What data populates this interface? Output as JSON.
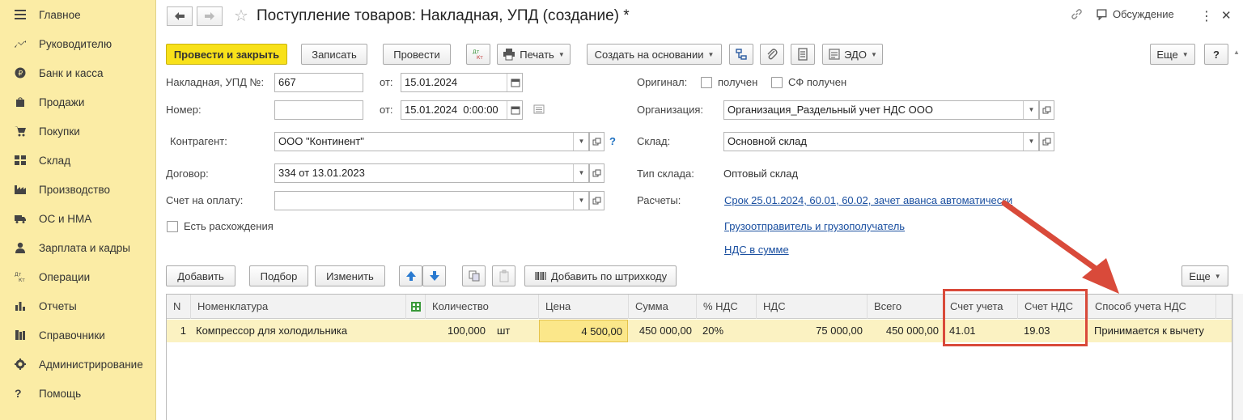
{
  "sidebar": {
    "items": [
      {
        "label": "Главное"
      },
      {
        "label": "Руководителю"
      },
      {
        "label": "Банк и касса"
      },
      {
        "label": "Продажи"
      },
      {
        "label": "Покупки"
      },
      {
        "label": "Склад"
      },
      {
        "label": "Производство"
      },
      {
        "label": "ОС и НМА"
      },
      {
        "label": "Зарплата и кадры"
      },
      {
        "label": "Операции"
      },
      {
        "label": "Отчеты"
      },
      {
        "label": "Справочники"
      },
      {
        "label": "Администрирование"
      },
      {
        "label": "Помощь"
      }
    ]
  },
  "window": {
    "title": "Поступление товаров: Накладная, УПД (создание) *",
    "discussion": "Обсуждение",
    "menu_dots": "⋮",
    "close": "✕"
  },
  "toolbar": {
    "post_close": "Провести и закрыть",
    "save": "Записать",
    "post": "Провести",
    "dtkt": "Дт Кт",
    "print": "Печать",
    "create_based": "Создать на основании",
    "edo": "ЭДО",
    "more": "Еще",
    "help": "?"
  },
  "form": {
    "invoice_label": "Накладная, УПД №:",
    "invoice_number": "667",
    "from_label": "от:",
    "invoice_date": "15.01.2024",
    "number_label": "Номер:",
    "number_value": "",
    "number_date": "15.01.2024  0:00:00",
    "counterparty_label": "Контрагент:",
    "counterparty": "ООО \"Континент\"",
    "help_q": "?",
    "contract_label": "Договор:",
    "contract": "334 от 13.01.2023",
    "payment_label": "Счет на оплату:",
    "payment": "",
    "discrepancy_label": "Есть расхождения",
    "original_label": "Оригинал:",
    "received_label": "получен",
    "sf_received_label": "СФ получен",
    "org_label": "Организация:",
    "organization": "Организация_Раздельный учет НДС ООО",
    "warehouse_label": "Склад:",
    "warehouse": "Основной склад",
    "warehouse_type_label": "Тип склада:",
    "warehouse_type": "Оптовый склад",
    "settlements_label": "Расчеты:",
    "settlements_link": "Срок 25.01.2024, 60.01, 60.02, зачет аванса автоматически",
    "shipper_link": "Грузоотправитель и грузополучатель",
    "vat_link": "НДС в сумме"
  },
  "table_toolbar": {
    "add": "Добавить",
    "select": "Подбор",
    "edit": "Изменить",
    "barcode": "Добавить по штрихкоду",
    "more": "Еще"
  },
  "table": {
    "columns": {
      "n": "N",
      "item": "Номенклатура",
      "qty": "Количество",
      "price": "Цена",
      "sum": "Сумма",
      "vat_rate": "% НДС",
      "vat": "НДС",
      "total": "Всего",
      "account": "Счет учета",
      "vat_account": "Счет НДС",
      "vat_method": "Способ учета НДС"
    },
    "rows": [
      {
        "n": "1",
        "item": "Компрессор для холодильника",
        "qty": "100,000",
        "unit": "шт",
        "price": "4 500,00",
        "sum": "450 000,00",
        "vat_rate": "20%",
        "vat": "75 000,00",
        "total": "450 000,00",
        "account": "41.01",
        "vat_account": "19.03",
        "vat_method": "Принимается к вычету"
      }
    ]
  },
  "colors": {
    "sidebar_bg": "#fbeca5",
    "primary_button": "#f8e11a",
    "link": "#1a4fa0",
    "annotation_red": "#d94a3a",
    "selected_row": "#fbf2c2"
  }
}
